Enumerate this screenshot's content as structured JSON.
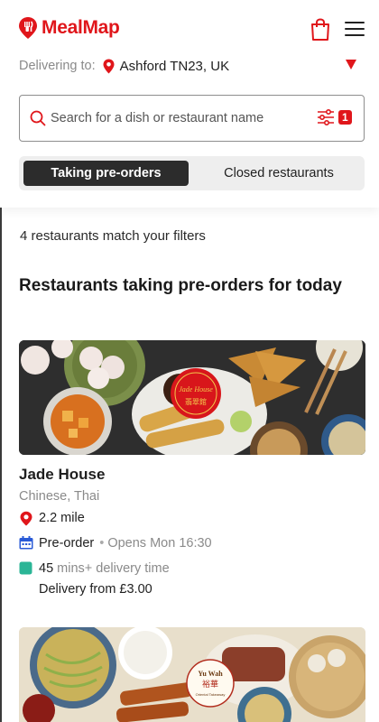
{
  "brand": {
    "name": "MealMap",
    "color": "#e0161b"
  },
  "header": {
    "delivering_label": "Delivering to:",
    "location": "Ashford TN23, UK",
    "cart_icon": "shopping-bag-icon",
    "menu_icon": "hamburger-menu-icon"
  },
  "search": {
    "placeholder": "Search for a dish or restaurant name",
    "value": "",
    "filter_count": "1"
  },
  "tabs": [
    {
      "label": "Taking pre-orders",
      "active": true
    },
    {
      "label": "Closed restaurants",
      "active": false
    }
  ],
  "results": {
    "count_text": "4 restaurants match your filters",
    "section_title": "Restaurants taking pre-orders for today"
  },
  "restaurants": [
    {
      "name": "Jade House",
      "cuisine": "Chinese, Thai",
      "distance": "2.2 mile",
      "order_mode": "Pre-order",
      "opens": "Opens Mon 16:30",
      "delivery_minutes": "45",
      "delivery_time_suffix": "mins+ delivery time",
      "delivery_fee": "Delivery from £3.00",
      "logo_text": "Jade House",
      "logo_chinese": "翡翠館",
      "logo_color": "#d8161b"
    },
    {
      "name": "Yu Wah",
      "logo_text": "Yu Wah",
      "logo_chinese": "裕華",
      "logo_subtitle": "Oriental Takeaway"
    }
  ]
}
